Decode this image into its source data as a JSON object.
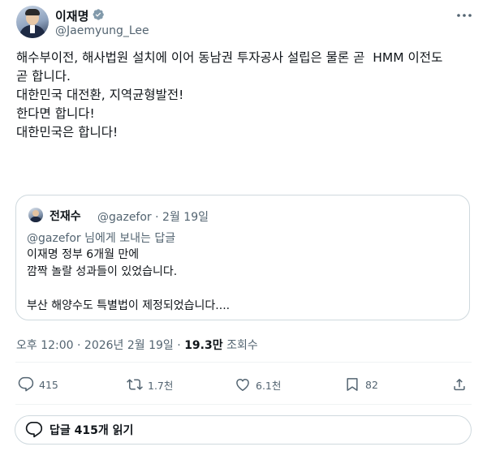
{
  "author": {
    "name": "이재명",
    "handle": "@Jaemyung_Lee"
  },
  "tweet": {
    "lines": [
      "해수부이전, 해사법원 설치에 이어 동남권 투자공사 설립은 물론 곧  HMM 이전도",
      "곧 합니다.",
      "",
      "대한민국 대전환, 지역균형발전!",
      "",
      "한다면 합니다!",
      "대한민국은 합니다!"
    ]
  },
  "quote": {
    "name": "전재수",
    "handle": "@gazefor",
    "dot": "·",
    "date": "2월 19일",
    "reply_mention": "@gazefor",
    "reply_suffix": " 님에게 보내는 답글",
    "lines": [
      "이재명 정부 6개월 만에",
      "깜짝 놀랄 성과들이 있었습니다.",
      "",
      "부산 해양수도 특별법이 제정되었습니다...."
    ]
  },
  "meta": {
    "time": "오후 12:00",
    "dot1": " · ",
    "date": "2026년 2월 19일",
    "dot2": " · ",
    "views": "19.3만",
    "views_label": " 조회수"
  },
  "actions": {
    "replies": "415",
    "retweets": "1.7천",
    "likes": "6.1천",
    "bookmarks": "82"
  },
  "read_replies": "답글 415개 읽기",
  "colors": {
    "verified": "#829aab",
    "secondary_text": "#536471",
    "border": "#cfd9de"
  }
}
